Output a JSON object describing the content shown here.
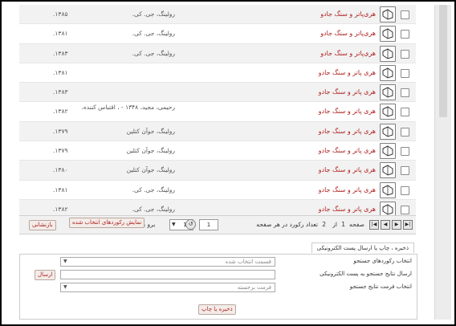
{
  "results": [
    {
      "title": "هری‌پاتر و سنگ جادو",
      "author": "رولینگ، جی. کی.",
      "year": "۱۳۸۵."
    },
    {
      "title": "هری‌پاتر و سنگ جادو",
      "author": "رولینگ، جی. کی.",
      "year": "۱۳۸۱."
    },
    {
      "title": "هری‌پاتر و سنگ جادو",
      "author": "رولینگ، جی. کی.",
      "year": "۱۳۸۳."
    },
    {
      "title": "هری پاتر و سنگ جادو",
      "author": "",
      "year": "۱۳۸۱."
    },
    {
      "title": "هری پاتر و سنگ جادو",
      "author": "",
      "year": "۱۳۸۳."
    },
    {
      "title": "هری پاتر و سنگ جادو",
      "author": "رحیمی، مجید، ۱۳۴۸ - ، اقتباس کننده.",
      "year": "۱۳۸۲."
    },
    {
      "title": "هری پاتر و سنگ جادو",
      "author": "رولینگ، جوآن کتلین",
      "year": "۱۳۷۹."
    },
    {
      "title": "هری پاتر و سنگ جادو",
      "author": "رولینگ، جوآن کتلین",
      "year": "۱۳۷۹."
    },
    {
      "title": "هری پاتر و سنگ جادو",
      "author": "رولینگ، جوآن کتلین",
      "year": "۱۳۸۰."
    },
    {
      "title": "هری پاتر و سنگ جادو",
      "author": "رولینگ، جی. کی.",
      "year": "۱۳۸۱."
    },
    {
      "title": "هری پاتر و سنگ جادو",
      "author": "رولینگ، جی. کی.",
      "year": "۱۳۸۲."
    }
  ],
  "pager": {
    "page_label": "صفحه",
    "current_page": "1",
    "of_label": "از",
    "total_pages": "2",
    "records_per_page_label": "تعداد رکورد در هر صفحه",
    "per_page_value": "15",
    "go_to_label": "برو به",
    "go_to_value": "1",
    "show_selected_button": "نمایش رکوردهای انتخاب شده",
    "reset_button": "بازنشانی"
  },
  "panel": {
    "tab_label": "ذخیره ، چاپ یا ارسال پست الکترونیکی",
    "select_records_label": "انتخاب رکوردهای جستجو",
    "select_records_value": "قسمت انتخاب شده",
    "email_label": "ارسال نتایج جستجو به پست الکترونیکی",
    "send_button": "ارسال",
    "format_label": "انتخاب فرمت نتایج جستجو",
    "format_value": "فرمت برجسته",
    "save_print_button": "ذخیره یا چاپ"
  }
}
